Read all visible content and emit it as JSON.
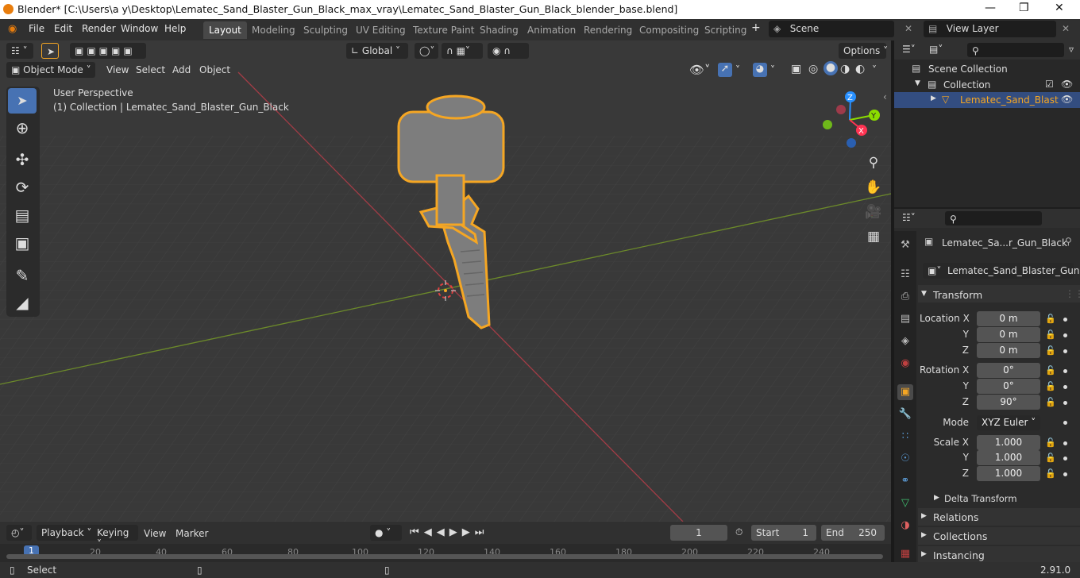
{
  "titlebar": {
    "title": "Blender* [C:\\Users\\a y\\Desktop\\Lematec_Sand_Blaster_Gun_Black_max_vray\\Lematec_Sand_Blaster_Gun_Black_blender_base.blend]"
  },
  "menu": {
    "items": [
      "File",
      "Edit",
      "Render",
      "Window",
      "Help"
    ]
  },
  "workspaces": [
    "Layout",
    "Modeling",
    "Sculpting",
    "UV Editing",
    "Texture Paint",
    "Shading",
    "Animation",
    "Rendering",
    "Compositing",
    "Scripting"
  ],
  "scene": {
    "name": "Scene",
    "view_layer": "View Layer"
  },
  "viewport": {
    "mode": "Object Mode",
    "menus": [
      "View",
      "Select",
      "Add",
      "Object"
    ],
    "orientation": "Global",
    "options": "Options",
    "perspective": "User Perspective",
    "collection_info": "(1) Collection | Lematec_Sand_Blaster_Gun_Black",
    "axes": {
      "x": "X",
      "y": "Y",
      "z": "Z"
    }
  },
  "outliner": {
    "scene_collection": "Scene Collection",
    "collection": "Collection",
    "object": "Lematec_Sand_Blast"
  },
  "properties": {
    "object_name": "Lematec_Sa...r_Gun_Black",
    "mesh_name": "Lematec_Sand_Blaster_Gun...",
    "transform_title": "Transform",
    "location": {
      "label": "Location X",
      "x": "0 m",
      "y": "0 m",
      "z": "0 m"
    },
    "rotation": {
      "label": "Rotation X",
      "x": "0°",
      "y": "0°",
      "z": "90°"
    },
    "mode_label": "Mode",
    "mode_value": "XYZ Euler",
    "scale": {
      "label": "Scale X",
      "x": "1.000",
      "y": "1.000",
      "z": "1.000"
    },
    "y_label": "Y",
    "z_label": "Z",
    "delta": "Delta Transform",
    "sections": [
      "Relations",
      "Collections",
      "Instancing"
    ]
  },
  "timeline": {
    "menus": [
      "Playback",
      "Keying",
      "View",
      "Marker"
    ],
    "current_frame": "1",
    "start_label": "Start",
    "start": "1",
    "end_label": "End",
    "end": "250",
    "frame_marks": [
      "1",
      "20",
      "40",
      "60",
      "80",
      "100",
      "120",
      "140",
      "160",
      "180",
      "200",
      "220",
      "240"
    ]
  },
  "statusbar": {
    "left": "Select",
    "version": "2.91.0"
  },
  "colors": {
    "accent": "#4772b3",
    "selection": "#f5a623",
    "x_axis": "#ff3352",
    "y_axis": "#8bdc00",
    "z_axis": "#2890ff"
  }
}
